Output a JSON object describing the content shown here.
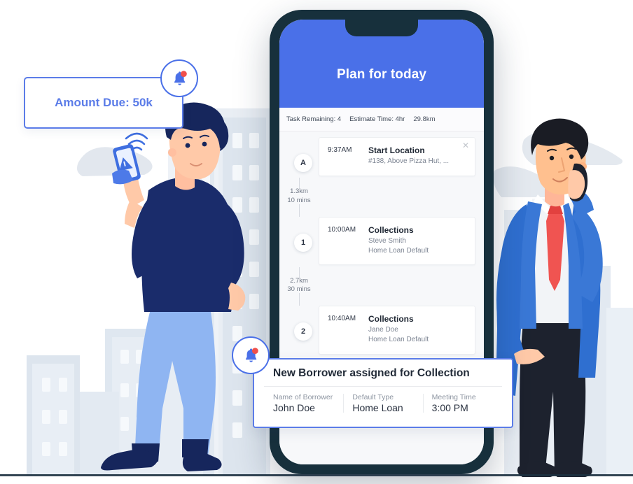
{
  "amount_card": {
    "text": "Amount Due: 50k",
    "bell_icon": "bell-notification-icon",
    "border_color": "#5b7ce8",
    "text_color": "#5b7ce8"
  },
  "phone": {
    "frame_color": "#17303c",
    "header_color": "#4a70e8",
    "screen_bg": "#f7f8fa",
    "title": "Plan for today",
    "stats": [
      {
        "label": "Task Remaining: 4"
      },
      {
        "label": "Estimate Time: 4hr"
      },
      {
        "label": "29.8km"
      }
    ],
    "steps": [
      {
        "marker": "A",
        "time": "9:37AM",
        "title": "Start Location",
        "lines": [
          "#138, Above Pizza Hut, ..."
        ],
        "close_icon": "close-icon",
        "has_close": true
      },
      {
        "marker": "1",
        "time": "10:00AM",
        "title": "Collections",
        "lines": [
          "Steve Smith",
          "Home Loan Default"
        ],
        "has_close": false
      },
      {
        "marker": "2",
        "time": "10:40AM",
        "title": "Collections",
        "lines": [
          "Jane Doe",
          "Home Loan Default"
        ],
        "has_close": false
      }
    ],
    "legs": [
      {
        "distance": "1.3km",
        "duration": "10 mins"
      },
      {
        "distance": "2.7km",
        "duration": "30 mins"
      }
    ]
  },
  "borrower_card": {
    "title": "New Borrower assigned for Collection",
    "bell_icon": "bell-notification-icon",
    "columns": [
      {
        "label": "Name of Borrower",
        "value": "John Doe"
      },
      {
        "label": "Default Type",
        "value": "Home Loan"
      },
      {
        "label": "Meeting Time",
        "value": "3:00 PM"
      }
    ]
  },
  "illustration": {
    "left_character": "young-man-with-phone",
    "right_character": "businessman-on-call",
    "background": "city-buildings",
    "colors": {
      "navy": "#152a5e",
      "light_blue": "#8fb5f2",
      "blue": "#2f6fd0",
      "red_tie": "#f05451",
      "skin": "#ffc9a8",
      "building": "#d7e0ea",
      "building_light": "#e8eef4",
      "cloud": "#e4e9ef"
    }
  }
}
